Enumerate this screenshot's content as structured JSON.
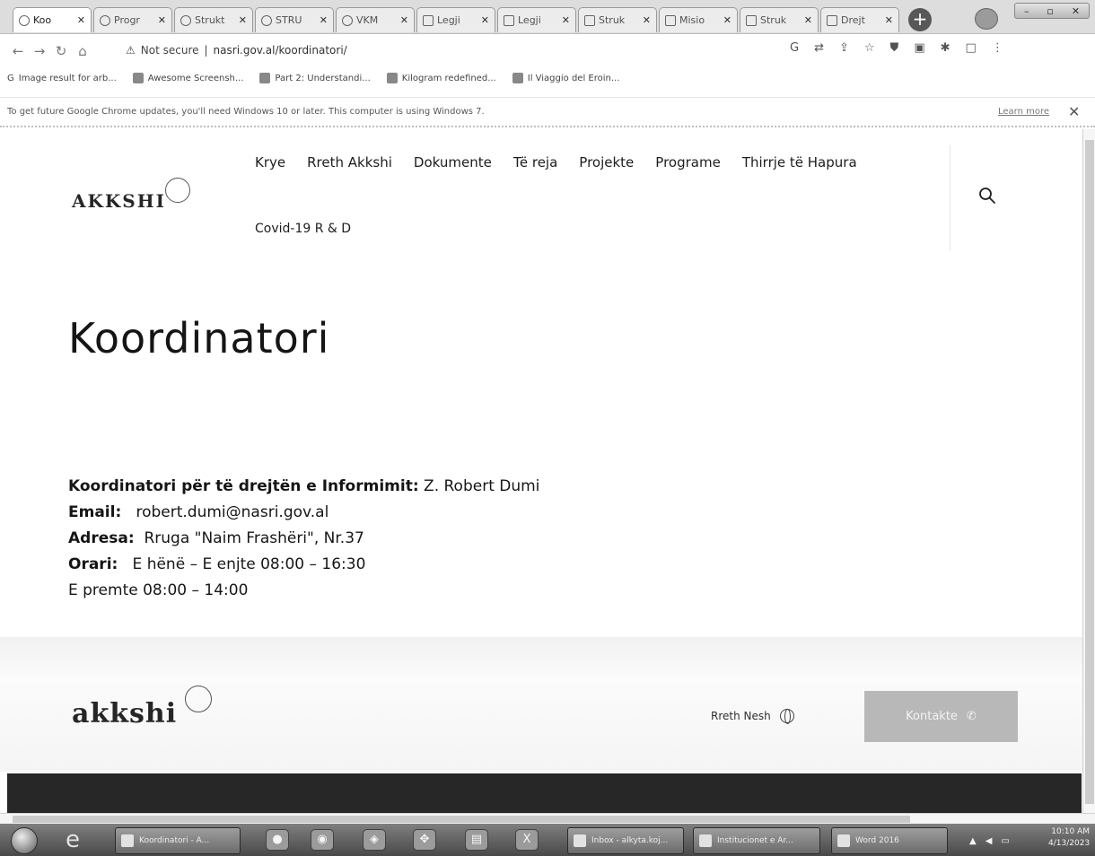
{
  "browser": {
    "tabs": [
      {
        "label": "Koo",
        "icon": "globe-icon",
        "active": true
      },
      {
        "label": "Progr",
        "icon": "globe-icon"
      },
      {
        "label": "Strukt",
        "icon": "globe-icon"
      },
      {
        "label": "STRU",
        "icon": "globe-icon"
      },
      {
        "label": "VKM",
        "icon": "globe-icon"
      },
      {
        "label": "Legji",
        "icon": "doc-icon"
      },
      {
        "label": "Legji",
        "icon": "doc-icon"
      },
      {
        "label": "Struk",
        "icon": "doc-icon"
      },
      {
        "label": "Misio",
        "icon": "doc-icon"
      },
      {
        "label": "Struk",
        "icon": "doc-icon"
      },
      {
        "label": "Drejt",
        "icon": "doc-icon"
      }
    ],
    "security_label": "Not secure",
    "url": "nasri.gov.al/koordinatori/",
    "bookmarks": [
      "Image result for arb...",
      "Awesome Screensh...",
      "Part 2: Understandi...",
      "Kilogram redefined...",
      "Il Viaggio del Eroin..."
    ],
    "infobar": {
      "message": "To get future Google Chrome updates, you'll need Windows 10 or later. This computer is using Windows 7.",
      "learn_more": "Learn more"
    }
  },
  "site": {
    "logo_text": "AKKSHI",
    "nav": [
      "Krye",
      "Rreth Akkshi",
      "Dokumente",
      "Të reja",
      "Projekte",
      "Programe",
      "Thirrje të Hapura"
    ],
    "nav_row2": "Covid-19 R & D",
    "page_title": "Koordinatori",
    "info": {
      "coordinator_label": "Koordinatori për të drejtën e Informimit:",
      "coordinator_value": "Z. Robert Dumi",
      "email_label": "Email:",
      "email_value": "robert.dumi@nasri.gov.al",
      "address_label": "Adresa:",
      "address_value": "Rruga \"Naim Frashëri\", Nr.37",
      "hours_label": "Orari:",
      "hours_value": "E hënë – E enjte 08:00 – 16:30",
      "hours_friday": "E premte 08:00 – 14:00"
    },
    "footer": {
      "logo_text": "akkshi",
      "about_link": "Rreth Nesh",
      "contact_button": "Kontakte"
    }
  },
  "taskbar": {
    "items": [
      {
        "label": "Koordinatori - A...",
        "icon": "chrome-icon"
      },
      {
        "label": "Inbox - alkyta.koj...",
        "icon": "outlook-icon"
      },
      {
        "label": "Institucionet e Ar...",
        "icon": "folder-icon"
      },
      {
        "label": "Word 2016",
        "icon": "word-icon"
      }
    ],
    "time": "10:10 AM",
    "date": "4/13/2023"
  }
}
